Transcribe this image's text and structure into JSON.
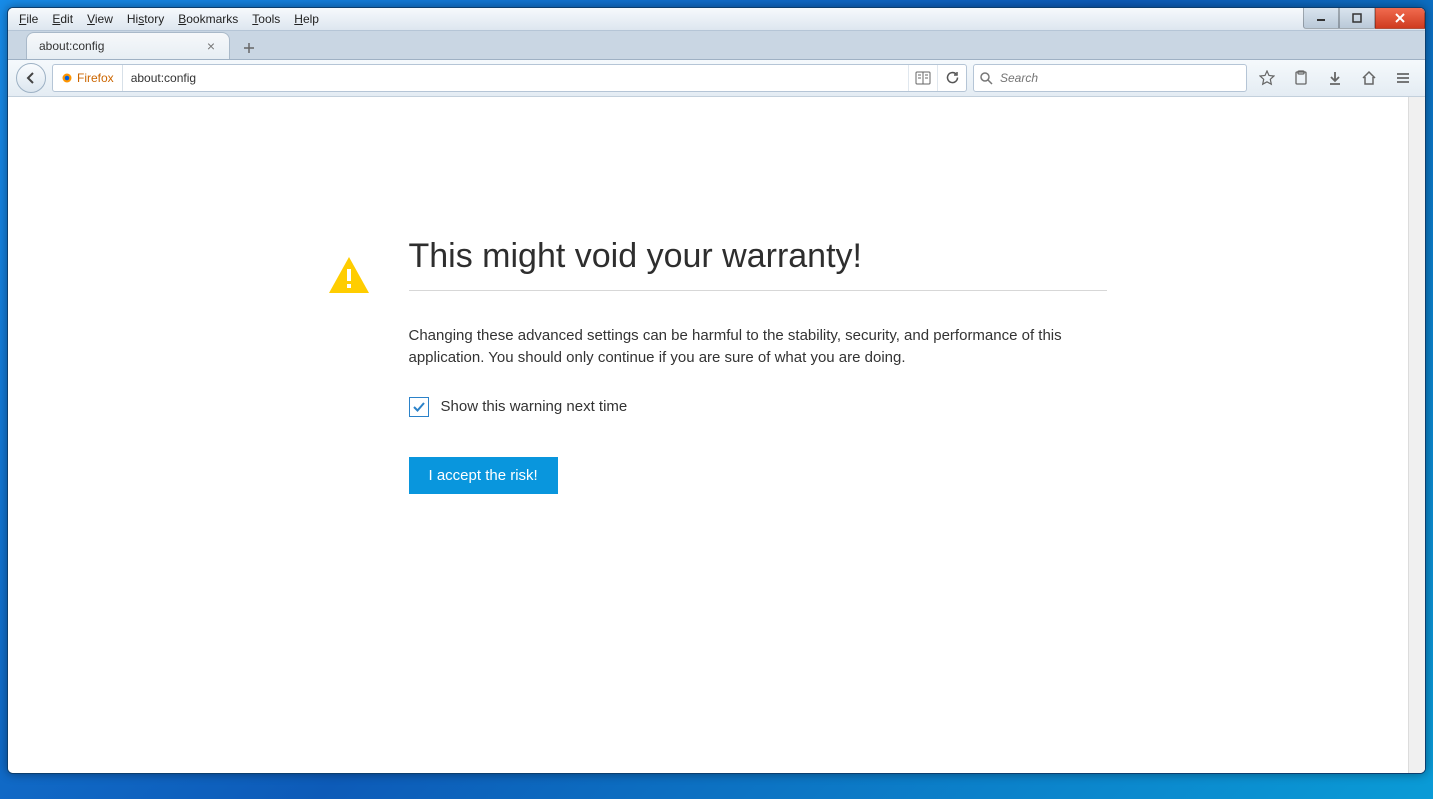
{
  "menubar": {
    "items": [
      {
        "key": "F",
        "label": "File"
      },
      {
        "key": "E",
        "label": "Edit"
      },
      {
        "key": "V",
        "label": "View"
      },
      {
        "key": "s",
        "label": "History"
      },
      {
        "key": "B",
        "label": "Bookmarks"
      },
      {
        "key": "T",
        "label": "Tools"
      },
      {
        "key": "H",
        "label": "Help"
      }
    ]
  },
  "tab": {
    "title": "about:config"
  },
  "urlbar": {
    "identity_label": "Firefox",
    "address": "about:config"
  },
  "searchbar": {
    "placeholder": "Search"
  },
  "page": {
    "title": "This might void your warranty!",
    "body": "Changing these advanced settings can be harmful to the stability, security, and performance of this application. You should only continue if you are sure of what you are doing.",
    "checkbox_label": "Show this warning next time",
    "checkbox_checked": true,
    "accept_label": "I accept the risk!"
  }
}
